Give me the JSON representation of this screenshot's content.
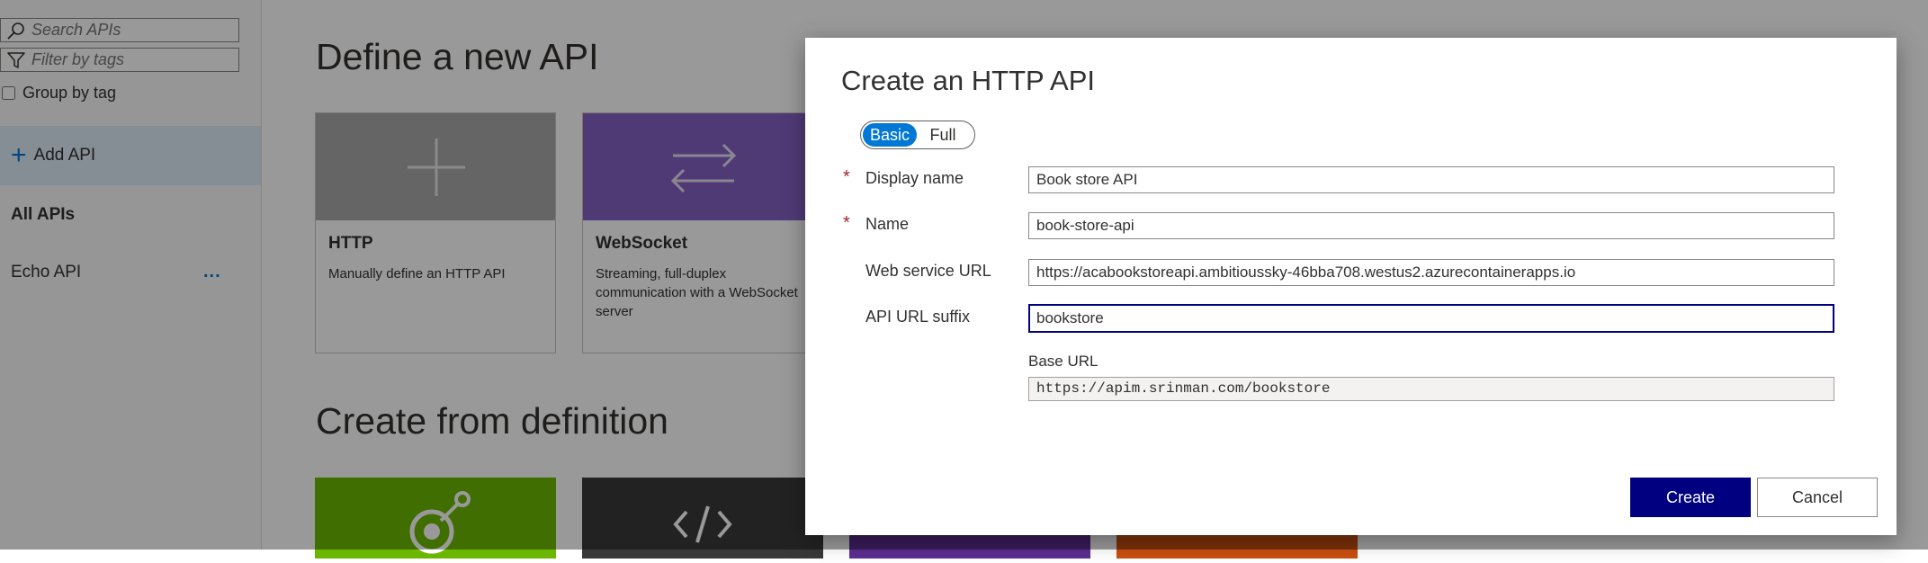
{
  "sidebar": {
    "search_placeholder": "Search APIs",
    "filter_placeholder": "Filter by tags",
    "group_by_tag_label": "Group by tag",
    "add_api_label": "Add API",
    "all_apis_label": "All APIs",
    "apis": [
      {
        "label": "Echo API",
        "more_label": "..."
      }
    ]
  },
  "main": {
    "define_heading": "Define a new API",
    "create_heading": "Create from definition",
    "cards": [
      {
        "name": "HTTP",
        "description": "Manually define an HTTP API",
        "color": "#a8a8a8",
        "icon": "plus-icon"
      },
      {
        "name": "WebSocket",
        "description": "Streaming, full-duplex communication with a WebSocket server",
        "color": "#8661c5",
        "icon": "exchange-arrows-icon"
      }
    ],
    "definition_cards": [
      {
        "icon": "openapi-icon",
        "color": "#6bb700"
      },
      {
        "icon": "code-icon",
        "color": "#393939"
      },
      {
        "icon": "unknown-icon",
        "color": "#5c2e91"
      },
      {
        "icon": "unknown-icon",
        "color": "#ca5010"
      }
    ]
  },
  "dialog": {
    "title": "Create an HTTP API",
    "mode_options": [
      "Basic",
      "Full"
    ],
    "selected_mode": "Basic",
    "fields": {
      "display_name": {
        "label": "Display name",
        "value": "Book store API",
        "required": true
      },
      "name": {
        "label": "Name",
        "value": "book-store-api",
        "required": true
      },
      "web_service_url": {
        "label": "Web service URL",
        "value": "https://acabookstoreapi.ambitioussky-46bba708.westus2.azurecontainerapps.io",
        "required": false
      },
      "api_url_suffix": {
        "label": "API URL suffix",
        "value": "bookstore",
        "required": false
      }
    },
    "base_url_label": "Base URL",
    "base_url_value": "https://apim.srinman.com/bookstore",
    "required_marker": "*",
    "create_label": "Create",
    "cancel_label": "Cancel"
  },
  "colors": {
    "accent": "#0078d4",
    "primary_button": "#000080",
    "required": "#a4262c",
    "overlay": "rgba(0,0,0,0.40)"
  }
}
